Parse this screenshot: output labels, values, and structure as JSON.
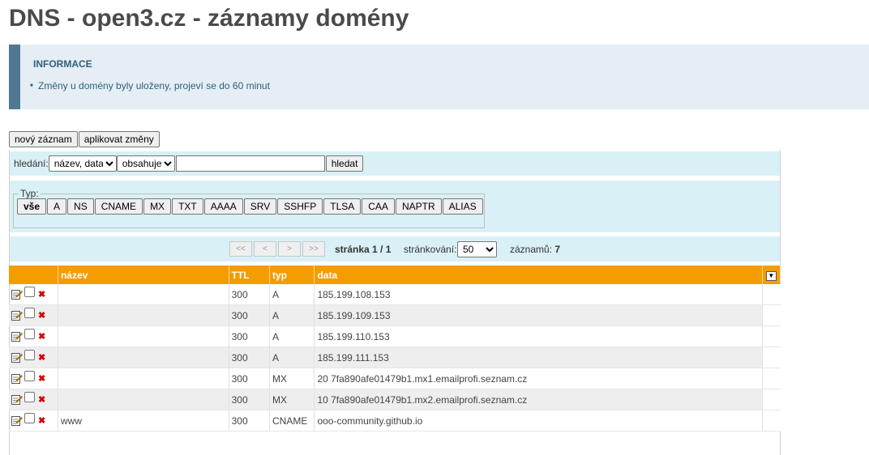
{
  "page": {
    "title": "DNS - open3.cz - záznamy domény"
  },
  "info": {
    "heading": "INFORMACE",
    "message": "Změny u domény byly uloženy, projeví se do 60 minut"
  },
  "toolbar": {
    "new_record": "nový záznam",
    "apply_changes": "aplikovat změny"
  },
  "search": {
    "label": "hledání:",
    "field_selected": "název, data",
    "mode_selected": "obsahuje",
    "query": "",
    "button": "hledat"
  },
  "type_filter": {
    "legend": "Typ:",
    "types": [
      "vše",
      "A",
      "NS",
      "CNAME",
      "MX",
      "TXT",
      "AAAA",
      "SRV",
      "SSHFP",
      "TLSA",
      "CAA",
      "NAPTR",
      "ALIAS"
    ],
    "selected": "vše"
  },
  "pager": {
    "first": "<<",
    "prev": "<",
    "next": ">",
    "last": ">>",
    "page_label": "stránka",
    "page_value": "1 / 1",
    "page_size_label": "stránkování:",
    "page_size": "50",
    "count_label": "záznamů:",
    "count": "7"
  },
  "table": {
    "headers": {
      "name": "název",
      "ttl": "TTL",
      "type": "typ",
      "data": "data"
    },
    "rows": [
      {
        "name": "",
        "ttl": "300",
        "type": "A",
        "data": "185.199.108.153"
      },
      {
        "name": "",
        "ttl": "300",
        "type": "A",
        "data": "185.199.109.153"
      },
      {
        "name": "",
        "ttl": "300",
        "type": "A",
        "data": "185.199.110.153"
      },
      {
        "name": "",
        "ttl": "300",
        "type": "A",
        "data": "185.199.111.153"
      },
      {
        "name": "",
        "ttl": "300",
        "type": "MX",
        "data": "20 7fa890afe01479b1.mx1.emailprofi.seznam.cz"
      },
      {
        "name": "",
        "ttl": "300",
        "type": "MX",
        "data": "10 7fa890afe01479b1.mx2.emailprofi.seznam.cz"
      },
      {
        "name": "www",
        "ttl": "300",
        "type": "CNAME",
        "data": "ooo-community.github.io"
      }
    ]
  },
  "colors": {
    "header_orange": "#f59c00",
    "panel_blue": "#d9f0f6",
    "info_bg": "#e5eef4",
    "info_accent": "#4f7892"
  }
}
